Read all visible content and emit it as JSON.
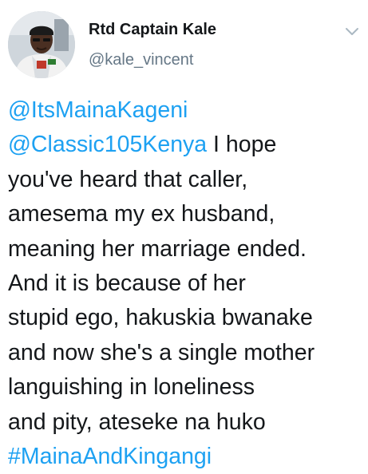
{
  "author": {
    "display_name": "Rtd Captain Kale",
    "handle": "@kale_vincent"
  },
  "icons": {
    "menu": "chevron-down-icon",
    "avatar": "profile-photo"
  },
  "colors": {
    "link": "#1da1f2",
    "text": "#14171a",
    "secondary": "#657786"
  },
  "tweet": {
    "mention1": "@ItsMainaKageni",
    "mention2": "@Classic105Kenya",
    "line2_text": " I hope",
    "line3": "you've heard that caller,",
    "line4": "amesema my ex husband,",
    "line5": "meaning her marriage ended.",
    "line6": "And it is because of her",
    "line7": "stupid ego, hakuskia bwanake",
    "line8": "and now she's a single mother",
    "line9": "languishing in loneliness",
    "line10": "and pity, ateseke na huko",
    "hashtag": "#MainaAndKingangi"
  }
}
